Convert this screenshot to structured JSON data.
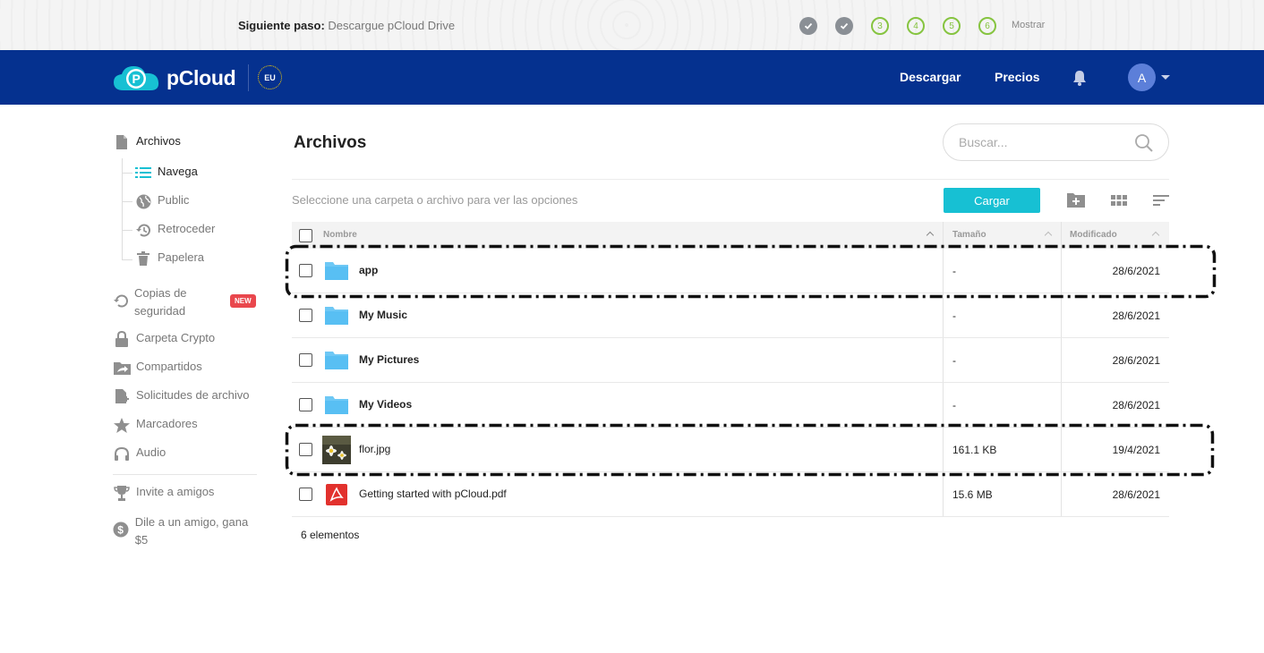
{
  "steps": {
    "next_label": "Siguiente paso:",
    "next_value": "Descargue pCloud Drive",
    "items": [
      {
        "label": "",
        "status": "done"
      },
      {
        "label": "",
        "status": "done"
      },
      {
        "label": "3",
        "status": "todo"
      },
      {
        "label": "4",
        "status": "todo"
      },
      {
        "label": "5",
        "status": "todo"
      },
      {
        "label": "6",
        "status": "todo"
      }
    ],
    "show_label": "Mostrar"
  },
  "header": {
    "brand": "pCloud",
    "region": "EU",
    "nav": [
      "Descargar",
      "Precios"
    ],
    "avatar_initial": "A",
    "bg_color": "#05318f"
  },
  "sidebar": {
    "files": "Archivos",
    "sub": [
      "Navega",
      "Public",
      "Retroceder",
      "Papelera"
    ],
    "backups": "Copias de seguridad",
    "backups_badge": "NEW",
    "crypto": "Carpeta Crypto",
    "shared": "Compartidos",
    "requests": "Solicitudes de archivo",
    "bookmarks": "Marcadores",
    "audio": "Audio",
    "invite": "Invite a amigos",
    "refer": "Dile a un amigo, gana $5"
  },
  "main": {
    "title": "Archivos",
    "search_placeholder": "Buscar...",
    "hint": "Seleccione una carpeta o archivo para ver las opciones",
    "upload_label": "Cargar",
    "accent_color": "#17c0d3",
    "columns": {
      "name": "Nombre",
      "size": "Tamaño",
      "modified": "Modificado"
    },
    "rows": [
      {
        "name": "app",
        "type": "folder",
        "size": "-",
        "modified": "28/6/2021"
      },
      {
        "name": "My Music",
        "type": "folder",
        "size": "-",
        "modified": "28/6/2021"
      },
      {
        "name": "My Pictures",
        "type": "folder",
        "size": "-",
        "modified": "28/6/2021"
      },
      {
        "name": "My Videos",
        "type": "folder",
        "size": "-",
        "modified": "28/6/2021"
      },
      {
        "name": "flor.jpg",
        "type": "image",
        "size": "161.1 KB",
        "modified": "19/4/2021"
      },
      {
        "name": "Getting started with pCloud.pdf",
        "type": "pdf",
        "size": "15.6 MB",
        "modified": "28/6/2021"
      }
    ],
    "count": "6 elementos"
  }
}
